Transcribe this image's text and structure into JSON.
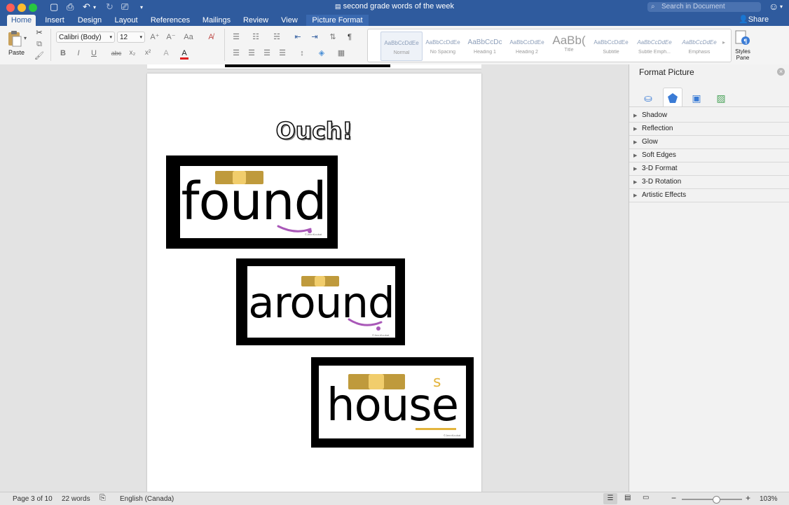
{
  "window": {
    "title": "second grade words of the week",
    "search_placeholder": "Search in Document",
    "share_label": "Share"
  },
  "tabs": [
    {
      "label": "Home",
      "active": true
    },
    {
      "label": "Insert"
    },
    {
      "label": "Design"
    },
    {
      "label": "Layout"
    },
    {
      "label": "References"
    },
    {
      "label": "Mailings"
    },
    {
      "label": "Review"
    },
    {
      "label": "View"
    },
    {
      "label": "Picture Format"
    }
  ],
  "ribbon": {
    "paste_label": "Paste",
    "font_name": "Calibri (Body)",
    "font_size": "12",
    "styles_pane_label": "Styles Pane",
    "styles": [
      {
        "preview": "AaBbCcDdEe",
        "name": "Normal"
      },
      {
        "preview": "AaBbCcDdEe",
        "name": "No Spacing"
      },
      {
        "preview": "AaBbCcDc",
        "name": "Heading 1"
      },
      {
        "preview": "AaBbCcDdEe",
        "name": "Heading 2"
      },
      {
        "preview": "AaBb(",
        "name": "Title"
      },
      {
        "preview": "AaBbCcDdEe",
        "name": "Subtitle"
      },
      {
        "preview": "AaBbCcDdEe",
        "name": "Subtle Emph..."
      },
      {
        "preview": "AaBbCcDdEe",
        "name": "Emphasis"
      }
    ]
  },
  "document": {
    "heading": "Ouch!",
    "cards": [
      {
        "word": "found",
        "copyright": "©JennKoubat"
      },
      {
        "word": "around",
        "copyright": "©JennKoubat"
      },
      {
        "word": "house",
        "extra_letter": "s",
        "copyright": "©JennKoubat"
      }
    ]
  },
  "format_pane": {
    "title": "Format Picture",
    "sections": [
      "Shadow",
      "Reflection",
      "Glow",
      "Soft Edges",
      "3-D Format",
      "3-D Rotation",
      "Artistic Effects"
    ]
  },
  "status": {
    "page": "Page 3 of 10",
    "words": "22 words",
    "language": "English (Canada)",
    "zoom": "103%"
  },
  "colors": {
    "accent": "#2f5b9e",
    "bandage_band": "#bf9a3c",
    "bandage_pad": "#f1cd6c",
    "smile_purple": "#a958b8",
    "smile_gold": "#e3b43c"
  }
}
